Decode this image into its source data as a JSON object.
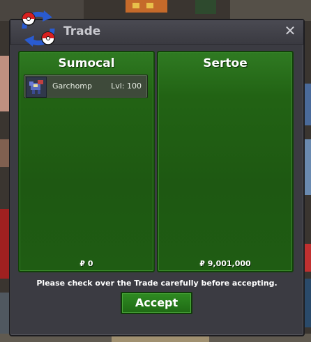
{
  "window": {
    "title": "Trade",
    "close_glyph": "✕"
  },
  "left_panel": {
    "player_name": "Sumocal",
    "items": [
      {
        "name": "Garchomp",
        "level": "Lvl: 100",
        "icon": "garchomp-sprite-icon"
      }
    ],
    "money": "₽ 0"
  },
  "right_panel": {
    "player_name": "Sertoe",
    "items": [],
    "money": "₽ 9,001,000"
  },
  "footer": {
    "notice": "Please check over the Trade carefully before accepting.",
    "accept_label": "Accept"
  },
  "colors": {
    "panel_green": "#226314",
    "window_bg": "#3b3b42",
    "accept_green": "#2f8b22"
  }
}
